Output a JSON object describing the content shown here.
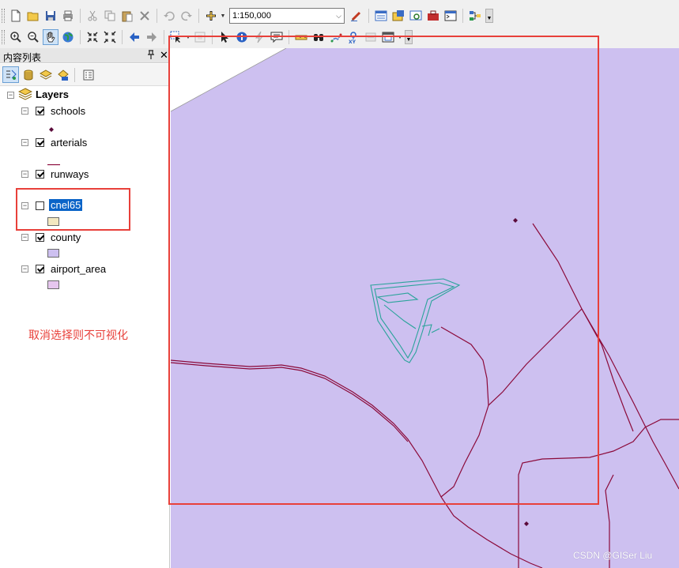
{
  "toolbar": {
    "scale_value": "1:150,000"
  },
  "toc": {
    "title": "内容列表",
    "pin_glyph": "ᵽ",
    "close_glyph": "✕",
    "root_label": "Layers",
    "layers": [
      {
        "name": "schools",
        "checked": true,
        "selected": false
      },
      {
        "name": "arterials",
        "checked": true,
        "selected": false
      },
      {
        "name": "runways",
        "checked": true,
        "selected": false
      },
      {
        "name": "cnel65",
        "checked": false,
        "selected": true
      },
      {
        "name": "county",
        "checked": true,
        "selected": false
      },
      {
        "name": "airport_area",
        "checked": true,
        "selected": false
      }
    ]
  },
  "annotation": {
    "text": "取消选择则不可视化"
  },
  "map": {
    "background_color": "#cdc0f0",
    "road_color": "#8b0a3a",
    "runway_color": "#2aa39a"
  },
  "watermark": "CSDN @GISer Liu",
  "colors": {
    "annotation_red": "#e8403a",
    "selection_blue": "#0a64c8"
  }
}
